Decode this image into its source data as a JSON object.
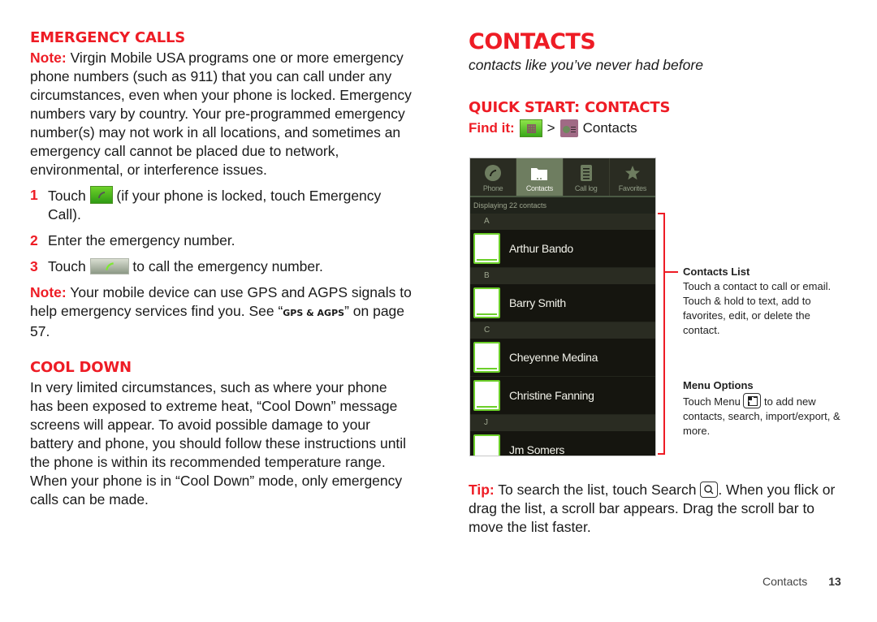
{
  "left": {
    "emergency": {
      "heading": "Emergency Calls",
      "note_label": "Note:",
      "note_text": " Virgin Mobile USA programs one or more emergency phone numbers (such as 911) that you can call under any circumstances, even when your phone is locked. Emergency numbers vary by country. Your pre-programmed emergency number(s) may not work in all locations, and sometimes an emergency call cannot be placed due to network, environmental, or interference issues.",
      "steps": [
        {
          "num": "1",
          "before": "Touch ",
          "icon": "phone-dialer-icon",
          "after": " (if your phone is locked, touch Emergency Call)."
        },
        {
          "num": "2",
          "text": "Enter the emergency number."
        },
        {
          "num": "3",
          "before": "Touch ",
          "icon": "call-button-icon",
          "after": " to call the emergency number."
        }
      ],
      "note2_label": "Note:",
      "note2_text": " Your mobile device can use GPS and AGPS signals to help emergency services find you. See “",
      "note2_xref": "GPS & AGPS",
      "note2_tail": "” on page 57."
    },
    "cooldown": {
      "heading": "Cool Down",
      "text": "In very limited circumstances, such as where your phone has been exposed to extreme heat, “Cool Down” message screens will appear. To avoid possible damage to your battery and phone, you should follow these instructions until the phone is within its recommended temperature range. When your phone is in “Cool Down” mode, only emergency calls can be made."
    }
  },
  "right": {
    "title": "Contacts",
    "subtitle": "contacts like you’ve never had before",
    "quickstart": "Quick Start: Contacts",
    "findit_label": "Find it:",
    "findit_sep": ">",
    "findit_target": "Contacts",
    "phone": {
      "tabs": [
        {
          "label": "Phone",
          "icon": "phone-icon",
          "active": false
        },
        {
          "label": "Contacts",
          "icon": "contacts-folder-icon",
          "active": true
        },
        {
          "label": "Call log",
          "icon": "call-log-icon",
          "active": false
        },
        {
          "label": "Favorites",
          "icon": "star-icon",
          "active": false
        }
      ],
      "displaying": "Displaying 22 contacts",
      "groups": [
        {
          "letter": "A",
          "contacts": [
            "Arthur Bando"
          ]
        },
        {
          "letter": "B",
          "contacts": [
            "Barry Smith"
          ]
        },
        {
          "letter": "C",
          "contacts": [
            "Cheyenne Medina",
            "Christine Fanning"
          ]
        },
        {
          "letter": "J",
          "contacts": [
            "Jm Somers"
          ]
        }
      ]
    },
    "callouts": {
      "list_title": "Contacts List",
      "list_text": "Touch a contact to call or email. Touch & hold to text, add to favorites, edit, or delete the contact.",
      "menu_title": "Menu Options",
      "menu_before": "Touch Menu ",
      "menu_after": " to add new contacts, search, import/export, & more."
    },
    "tip": {
      "label": "Tip:",
      "before": " To search the list, touch Search ",
      "after": ". When you flick or drag the list, a scroll bar appears. Drag the scroll bar to move the list faster."
    }
  },
  "footer": {
    "section": "Contacts",
    "page": "13"
  }
}
